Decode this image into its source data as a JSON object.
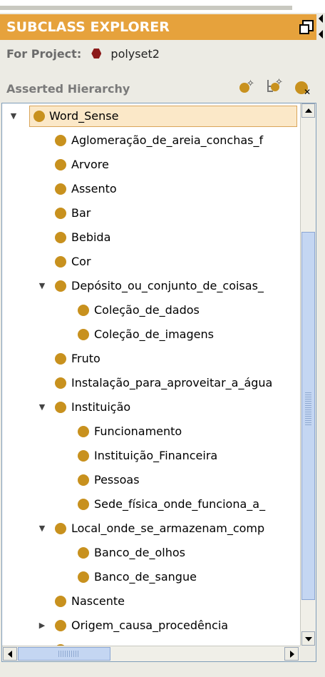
{
  "panel": {
    "title": "SUBCLASS EXPLORER",
    "project_label": "For Project:",
    "project_name": "polyset2",
    "hierarchy_label": "Asserted Hierarchy",
    "toolbar_icons": [
      "create-subclass-icon",
      "create-sibling-icon",
      "delete-class-icon"
    ]
  },
  "tree": {
    "rows": [
      {
        "label": "Word_Sense",
        "toggle": "expanded",
        "level": 0,
        "selected": true
      },
      {
        "label": "Aglomeração_de_areia_conchas_f",
        "toggle": "none",
        "level": 1
      },
      {
        "label": "Arvore",
        "toggle": "none",
        "level": 1
      },
      {
        "label": "Assento",
        "toggle": "none",
        "level": 1
      },
      {
        "label": "Bar",
        "toggle": "none",
        "level": 1
      },
      {
        "label": "Bebida",
        "toggle": "none",
        "level": 1
      },
      {
        "label": "Cor",
        "toggle": "none",
        "level": 1
      },
      {
        "label": "Depósito_ou_conjunto_de_coisas_",
        "toggle": "expanded",
        "level": 1
      },
      {
        "label": "Coleção_de_dados",
        "toggle": "none",
        "level": 2
      },
      {
        "label": "Coleção_de_imagens",
        "toggle": "none",
        "level": 2
      },
      {
        "label": "Fruto",
        "toggle": "none",
        "level": 1
      },
      {
        "label": "Instalação_para_aproveitar_a_água",
        "toggle": "none",
        "level": 1
      },
      {
        "label": "Instituição",
        "toggle": "expanded",
        "level": 1
      },
      {
        "label": "Funcionamento",
        "toggle": "none",
        "level": 2
      },
      {
        "label": "Instituição_Financeira",
        "toggle": "none",
        "level": 2
      },
      {
        "label": "Pessoas",
        "toggle": "none",
        "level": 2
      },
      {
        "label": "Sede_física_onde_funciona_a_",
        "toggle": "none",
        "level": 2
      },
      {
        "label": "Local_onde_se_armazenam_comp",
        "toggle": "expanded",
        "level": 1
      },
      {
        "label": "Banco_de_olhos",
        "toggle": "none",
        "level": 2
      },
      {
        "label": "Banco_de_sangue",
        "toggle": "none",
        "level": 2
      },
      {
        "label": "Nascente",
        "toggle": "none",
        "level": 1
      },
      {
        "label": "Origem_causa_procedência",
        "toggle": "collapsed",
        "level": 1
      },
      {
        "label": "",
        "toggle": "none",
        "level": 1
      }
    ],
    "class_icon_color": "#c8911e",
    "selection_color": "#fbe8c8"
  },
  "colors": {
    "title_bar": "#e6a23c",
    "project_icon": "#8b1a1a",
    "scroll_thumb": "#c4d6f2"
  }
}
